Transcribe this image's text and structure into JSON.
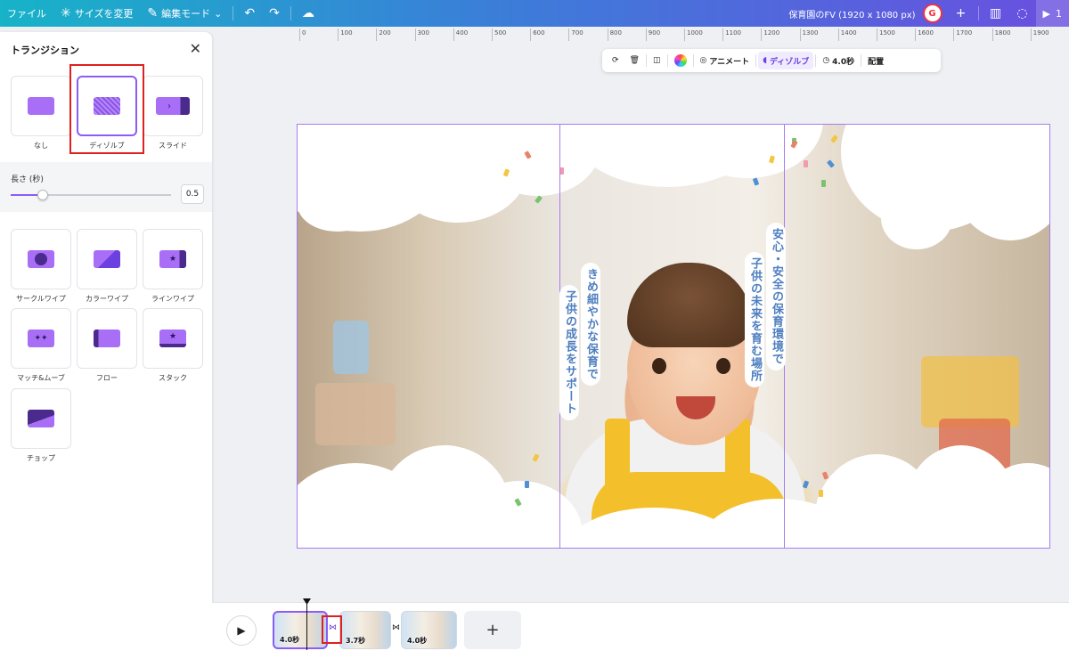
{
  "topbar": {
    "file": "ファイル",
    "resize": "サイズを変更",
    "edit_mode": "編集モード",
    "doc_title": "保育園のFV (1920 x 1080 px)",
    "present_label": "1"
  },
  "panel": {
    "title": "トランジション",
    "top_transitions": [
      "なし",
      "ディゾルブ",
      "スライド"
    ],
    "duration_label": "長さ (秒)",
    "duration_value": "0.5",
    "duration_fraction": 0.2,
    "more_transitions": [
      "サークルワイプ",
      "カラーワイプ",
      "ラインワイプ",
      "マッチ&ムーブ",
      "フロー",
      "スタック",
      "チョップ"
    ],
    "selected": "ディゾルブ"
  },
  "ruler": [
    "0",
    "100",
    "200",
    "300",
    "400",
    "500",
    "600",
    "700",
    "800",
    "900",
    "1000",
    "1100",
    "1200",
    "1300",
    "1400",
    "1500",
    "1600",
    "1700",
    "1800",
    "1900"
  ],
  "toolbar": {
    "animate": "アニメート",
    "dissolve": "ディゾルブ",
    "duration": "4.0秒",
    "arrange": "配置"
  },
  "canvas": {
    "text_1": "子供の成長をサポート",
    "text_2": "きめ細やかな保育で",
    "text_3": "子供の未来を育む場所",
    "text_4": "安心・安全の保育環境で"
  },
  "timeline": {
    "clips": [
      "4.0秒",
      "3.7秒",
      "4.0秒"
    ],
    "add": "+"
  },
  "colors": {
    "accent": "#8b5cf6",
    "annotation": "#e02020",
    "text_blue": "#4f7fc0"
  }
}
